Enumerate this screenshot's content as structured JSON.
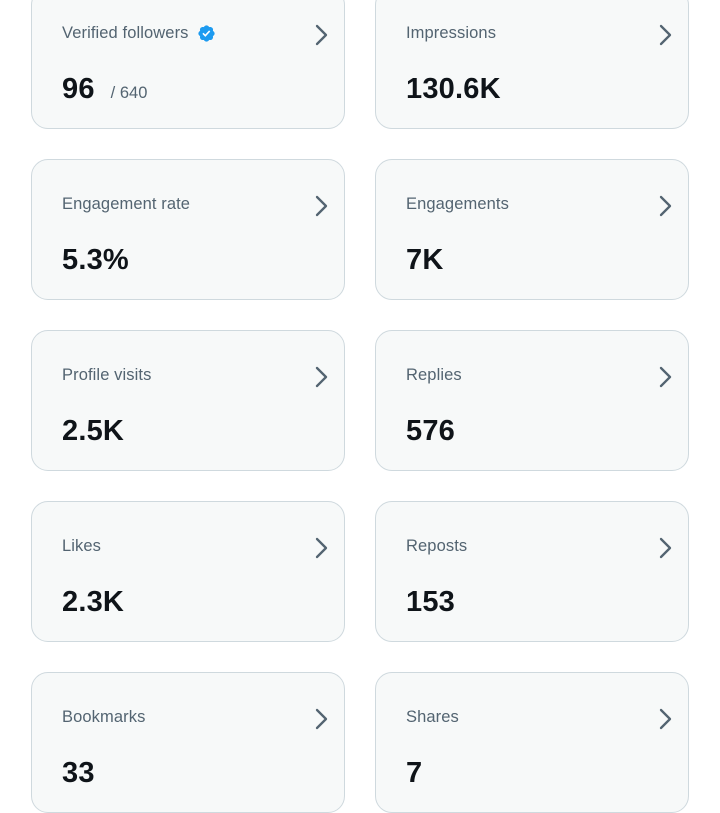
{
  "colors": {
    "card_background": "#f7f9f9",
    "card_border": "#cfd9de",
    "label": "#536471",
    "value": "#0f1419",
    "verified_badge": "#1d9bf0"
  },
  "icons": {
    "verified": "verified-badge-icon",
    "chevron": "chevron-right-icon"
  },
  "metrics": [
    {
      "label": "Verified followers",
      "value": "96",
      "sub": "/ 640"
    },
    {
      "label": "Impressions",
      "value": "130.6K"
    },
    {
      "label": "Engagement rate",
      "value": "5.3%"
    },
    {
      "label": "Engagements",
      "value": "7K"
    },
    {
      "label": "Profile visits",
      "value": "2.5K"
    },
    {
      "label": "Replies",
      "value": "576"
    },
    {
      "label": "Likes",
      "value": "2.3K"
    },
    {
      "label": "Reposts",
      "value": "153"
    },
    {
      "label": "Bookmarks",
      "value": "33"
    },
    {
      "label": "Shares",
      "value": "7"
    }
  ]
}
